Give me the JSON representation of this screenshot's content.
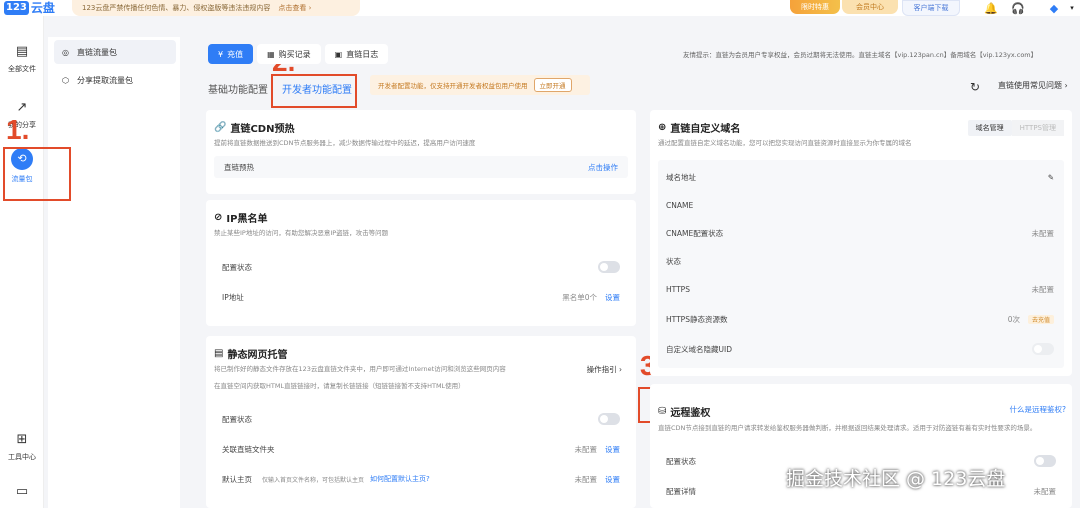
{
  "brand": {
    "mark": "123",
    "name": "云盘"
  },
  "notice": {
    "text": "123云盘严禁传播任何色情、暴力、侵权盗版等违法违规内容",
    "link": "点击查看 ›"
  },
  "promos": {
    "p1": "限时特惠",
    "p2": "会员中心",
    "p3": "客户端下载"
  },
  "left_nav": [
    {
      "label": "全部文件",
      "icon": "file-icon"
    },
    {
      "label": "我的分享",
      "icon": "share-icon"
    },
    {
      "label": "流量包",
      "icon": "traffic-icon"
    },
    {
      "label": "工具中心",
      "icon": "grid-icon"
    },
    {
      "label": "",
      "icon": "monitor-icon"
    }
  ],
  "sub_nav": [
    {
      "label": "直链流量包",
      "icon": "direct-link-icon"
    },
    {
      "label": "分享提取流量包",
      "icon": "share-package-icon"
    }
  ],
  "annotations": {
    "a1": "1.",
    "a2": "2.",
    "a3": "3."
  },
  "top_tabs": [
    {
      "label": "充值",
      "icon": "yen-icon"
    },
    {
      "label": "购买记录",
      "icon": "receipt-icon"
    },
    {
      "label": "直链日志",
      "icon": "log-icon"
    }
  ],
  "tip": "友情提示：直链为会员用户专享权益，会员过期将无法使用。直链主域名【vip.123pan.cn】备用域名【vip.123yx.com】",
  "sub_tabs": {
    "basic": "基础功能配置",
    "dev": "开发者功能配置"
  },
  "open_hint": {
    "text": "开发者配置功能，仅支持开通开发者权益包用户使用",
    "button": "立即开通"
  },
  "faq": "直链使用常见问题 ›",
  "cdn": {
    "title": "直链CDN预热",
    "desc": "提前将直链数据推送到CDN节点服务器上，减少数据传输过程中的延迟，提高用户访问速度",
    "row_label": "直链预热",
    "row_action": "点击操作"
  },
  "ip_blacklist": {
    "title": "IP黑名单",
    "desc": "禁止某些IP地址的访问，有助您解决恶意IP盗链，攻击等问题",
    "status_label": "配置状态",
    "ip_label": "IP地址",
    "ip_count": "黑名单0个",
    "ip_action": "设置"
  },
  "static_hosting": {
    "title": "静态网页托管",
    "desc1": "将已制作好的静态文件存放在123云盘直链文件夹中，用户即可通过Internet访问和浏览这些网页内容",
    "desc2": "在直链空间内获取HTML直链链接时，请复制长链链接（短链链接暂不支持HTML使用）",
    "guide": "操作指引 ›",
    "status_label": "配置状态",
    "folder_label": "关联直链文件夹",
    "folder_status": "未配置",
    "folder_action": "设置",
    "home_label": "默认主页",
    "home_placeholder": "仅输入首页文件名称，可包括默认主页",
    "home_link": "如何配置默认主页?",
    "home_status": "未配置",
    "home_action": "设置"
  },
  "domain": {
    "title": "直链自定义域名",
    "desc": "通过配置直链自定义域名功能，您可以把您实现访问直链资源时直接显示为你专属的域名",
    "tab_manage": "域名管理",
    "tab_https": "HTTPS管理",
    "rows": {
      "addr": "域名地址",
      "cname": "CNAME",
      "cname_status_label": "CNAME配置状态",
      "cname_status": "未配置",
      "state": "状态",
      "https": "HTTPS",
      "https_value": "未配置",
      "https_count_label": "HTTPS静态资源数",
      "https_count": "0次",
      "https_count_badge": "去充值",
      "uid_label": "自定义域名隐藏UID"
    }
  },
  "remote_auth": {
    "title": "远程鉴权",
    "what": "什么是远程鉴权?",
    "desc": "直链CDN节点接到直链的用户请求转发给鉴权服务器做判断，并根据返回结果处理请求。适用于对防盗链有着有实时性要求的场景。",
    "status_label": "配置状态",
    "detail_label": "配置详情",
    "detail_status": "未配置"
  },
  "watermark": "掘金技术社区 @ 123云盘"
}
